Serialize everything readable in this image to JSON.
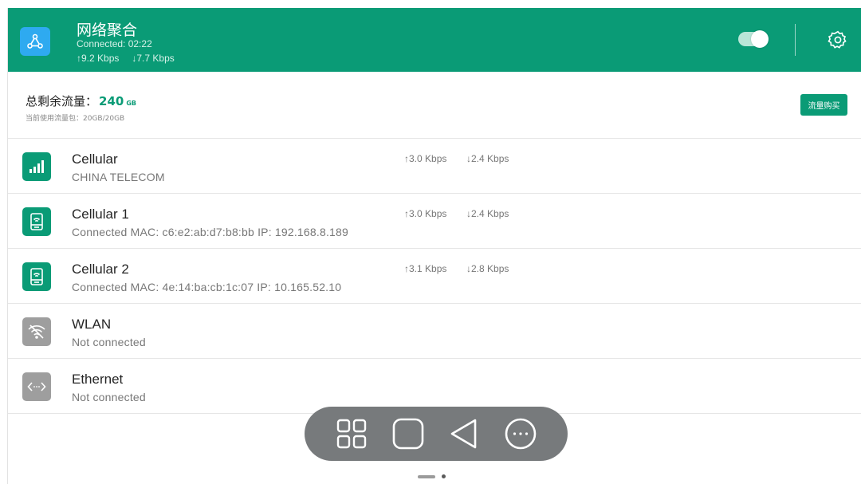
{
  "header": {
    "title": "网络聚合",
    "status": "Connected: 02:22",
    "upload": "↑9.2 Kbps",
    "download": "↓7.7 Kbps",
    "toggle_on": true
  },
  "quota": {
    "label": "总剩余流量：",
    "value": "240",
    "unit": "GB",
    "sub": "当前使用流量包：20GB/20GB",
    "buy_label": "流量购买"
  },
  "connections": [
    {
      "name": "Cellular",
      "detail": "CHINA TELECOM",
      "up": "↑3.0 Kbps",
      "down": "↓2.4 Kbps",
      "icon": "signal-bars-icon",
      "state": "active"
    },
    {
      "name": "Cellular 1",
      "detail": "Connected MAC: c6:e2:ab:d7:b8:bb IP: 192.168.8.189",
      "up": "↑3.0 Kbps",
      "down": "↓2.4 Kbps",
      "icon": "usb-modem-icon",
      "state": "active"
    },
    {
      "name": "Cellular 2",
      "detail": "Connected MAC: 4e:14:ba:cb:1c:07 IP: 10.165.52.10",
      "up": "↑3.1 Kbps",
      "down": "↓2.8 Kbps",
      "icon": "usb-modem-icon",
      "state": "active"
    },
    {
      "name": "WLAN",
      "detail": "Not connected",
      "up": "",
      "down": "",
      "icon": "wifi-off-icon",
      "state": "inactive"
    },
    {
      "name": "Ethernet",
      "detail": "Not connected",
      "up": "",
      "down": "",
      "icon": "ethernet-icon",
      "state": "inactive"
    }
  ],
  "colors": {
    "header_bg": "#0a9b76",
    "accent": "#0a9b76",
    "app_icon_bg": "#2eaaf0",
    "inactive_icon_bg": "#9e9e9e",
    "navbar_bg": "#777a7c"
  },
  "navbar": [
    "apps-grid-icon",
    "home-square-icon",
    "back-triangle-icon",
    "more-circle-icon"
  ]
}
